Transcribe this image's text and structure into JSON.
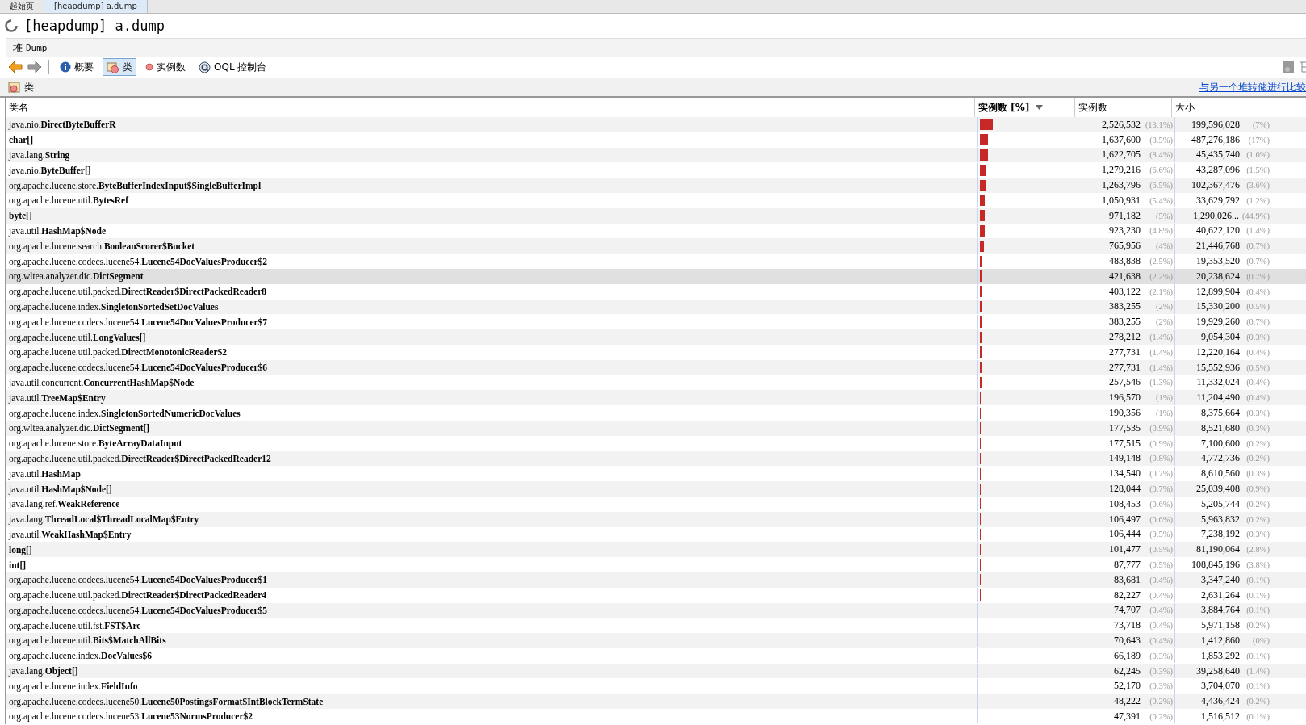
{
  "tabs": [
    {
      "label": "起始页",
      "selected": false
    },
    {
      "label": "[heapdump] a.dump",
      "selected": true
    }
  ],
  "title": "[heapdump] a.dump",
  "breadcrumb": {
    "root": "堆",
    "item": "Dump"
  },
  "toolbar": [
    {
      "kind": "info",
      "label": "概要",
      "selected": false
    },
    {
      "kind": "classes",
      "label": "类",
      "selected": true
    },
    {
      "kind": "instances",
      "label": "实例数",
      "selected": false
    },
    {
      "kind": "oql",
      "label": "OQL 控制台",
      "selected": false
    }
  ],
  "section": {
    "title": "类",
    "link": "与另一个堆转储进行比较"
  },
  "table": {
    "columns": [
      "类名",
      "实例数 [%]",
      "实例数",
      "大小"
    ],
    "rows": [
      {
        "package": "java.nio.",
        "class_name": "DirectByteBufferR",
        "level": 0.131,
        "count": "2,526,532",
        "count_pct": "(13.1%)",
        "size": "199,596,028",
        "size_pct": "(7%)",
        "selected": false
      },
      {
        "class_name": "char[]",
        "level": 0.085,
        "count": "1,637,600",
        "count_pct": "(8.5%)",
        "size": "487,276,186",
        "size_pct": "(17%)",
        "selected": false
      },
      {
        "package": "java.lang.",
        "class_name": "String",
        "level": 0.084,
        "count": "1,622,705",
        "count_pct": "(8.4%)",
        "size": "45,435,740",
        "size_pct": "(1.6%)",
        "selected": false
      },
      {
        "package": "java.nio.",
        "class_name": "ByteBuffer[]",
        "level": 0.066,
        "count": "1,279,216",
        "count_pct": "(6.6%)",
        "size": "43,287,096",
        "size_pct": "(1.5%)",
        "selected": false
      },
      {
        "package": "org.apache.lucene.store.",
        "class_name": "ByteBufferIndexInput$SingleBufferImpl",
        "level": 0.065,
        "count": "1,263,796",
        "count_pct": "(6.5%)",
        "size": "102,367,476",
        "size_pct": "(3.6%)",
        "selected": false
      },
      {
        "package": "org.apache.lucene.util.",
        "class_name": "BytesRef",
        "level": 0.054,
        "count": "1,050,931",
        "count_pct": "(5.4%)",
        "size": "33,629,792",
        "size_pct": "(1.2%)",
        "selected": false
      },
      {
        "class_name": "byte[]",
        "level": 0.05,
        "count": "971,182",
        "count_pct": "(5%)",
        "size": "1,290,026...",
        "size_pct": "(44.9%)",
        "selected": false
      },
      {
        "package": "java.util.",
        "class_name": "HashMap$Node",
        "level": 0.048,
        "count": "923,230",
        "count_pct": "(4.8%)",
        "size": "40,622,120",
        "size_pct": "(1.4%)",
        "selected": false
      },
      {
        "package": "org.apache.lucene.search.",
        "class_name": "BooleanScorer$Bucket",
        "level": 0.04,
        "count": "765,956",
        "count_pct": "(4%)",
        "size": "21,446,768",
        "size_pct": "(0.7%)",
        "selected": false
      },
      {
        "package": "org.apache.lucene.codecs.lucene54.",
        "class_name": "Lucene54DocValuesProducer$2",
        "level": 0.025,
        "count": "483,838",
        "count_pct": "(2.5%)",
        "size": "19,353,520",
        "size_pct": "(0.7%)",
        "selected": false
      },
      {
        "package": "org.wltea.analyzer.dic.",
        "class_name": "DictSegment",
        "level": 0.022,
        "count": "421,638",
        "count_pct": "(2.2%)",
        "size": "20,238,624",
        "size_pct": "(0.7%)",
        "selected": true
      },
      {
        "package": "org.apache.lucene.util.packed.",
        "class_name": "DirectReader$DirectPackedReader8",
        "level": 0.021,
        "count": "403,122",
        "count_pct": "(2.1%)",
        "size": "12,899,904",
        "size_pct": "(0.4%)",
        "selected": false
      },
      {
        "package": "org.apache.lucene.index.",
        "class_name": "SingletonSortedSetDocValues",
        "level": 0.02,
        "count": "383,255",
        "count_pct": "(2%)",
        "size": "15,330,200",
        "size_pct": "(0.5%)",
        "selected": false
      },
      {
        "package": "org.apache.lucene.codecs.lucene54.",
        "class_name": "Lucene54DocValuesProducer$7",
        "level": 0.02,
        "count": "383,255",
        "count_pct": "(2%)",
        "size": "19,929,260",
        "size_pct": "(0.7%)",
        "selected": false
      },
      {
        "package": "org.apache.lucene.util.",
        "class_name": "LongValues[]",
        "level": 0.014,
        "count": "278,212",
        "count_pct": "(1.4%)",
        "size": "9,054,304",
        "size_pct": "(0.3%)",
        "selected": false
      },
      {
        "package": "org.apache.lucene.util.packed.",
        "class_name": "DirectMonotonicReader$2",
        "level": 0.014,
        "count": "277,731",
        "count_pct": "(1.4%)",
        "size": "12,220,164",
        "size_pct": "(0.4%)",
        "selected": false
      },
      {
        "package": "org.apache.lucene.codecs.lucene54.",
        "class_name": "Lucene54DocValuesProducer$6",
        "level": 0.014,
        "count": "277,731",
        "count_pct": "(1.4%)",
        "size": "15,552,936",
        "size_pct": "(0.5%)",
        "selected": false
      },
      {
        "package": "java.util.concurrent.",
        "class_name": "ConcurrentHashMap$Node",
        "level": 0.013,
        "count": "257,546",
        "count_pct": "(1.3%)",
        "size": "11,332,024",
        "size_pct": "(0.4%)",
        "selected": false
      },
      {
        "package": "java.util.",
        "class_name": "TreeMap$Entry",
        "level": 0.01,
        "count": "196,570",
        "count_pct": "(1%)",
        "size": "11,204,490",
        "size_pct": "(0.4%)",
        "selected": false
      },
      {
        "package": "org.apache.lucene.index.",
        "class_name": "SingletonSortedNumericDocValues",
        "level": 0.01,
        "count": "190,356",
        "count_pct": "(1%)",
        "size": "8,375,664",
        "size_pct": "(0.3%)",
        "selected": false
      },
      {
        "package": "org.wltea.analyzer.dic.",
        "class_name": "DictSegment[]",
        "level": 0.009,
        "count": "177,535",
        "count_pct": "(0.9%)",
        "size": "8,521,680",
        "size_pct": "(0.3%)",
        "selected": false
      },
      {
        "package": "org.apache.lucene.store.",
        "class_name": "ByteArrayDataInput",
        "level": 0.009,
        "count": "177,515",
        "count_pct": "(0.9%)",
        "size": "7,100,600",
        "size_pct": "(0.2%)",
        "selected": false
      },
      {
        "package": "org.apache.lucene.util.packed.",
        "class_name": "DirectReader$DirectPackedReader12",
        "level": 0.008,
        "count": "149,148",
        "count_pct": "(0.8%)",
        "size": "4,772,736",
        "size_pct": "(0.2%)",
        "selected": false
      },
      {
        "package": "java.util.",
        "class_name": "HashMap",
        "level": 0.007,
        "count": "134,540",
        "count_pct": "(0.7%)",
        "size": "8,610,560",
        "size_pct": "(0.3%)",
        "selected": false
      },
      {
        "package": "java.util.",
        "class_name": "HashMap$Node[]",
        "level": 0.007,
        "count": "128,044",
        "count_pct": "(0.7%)",
        "size": "25,039,408",
        "size_pct": "(0.9%)",
        "selected": false
      },
      {
        "package": "java.lang.ref.",
        "class_name": "WeakReference",
        "level": 0.006,
        "count": "108,453",
        "count_pct": "(0.6%)",
        "size": "5,205,744",
        "size_pct": "(0.2%)",
        "selected": false
      },
      {
        "package": "java.lang.",
        "class_name": "ThreadLocal$ThreadLocalMap$Entry",
        "level": 0.006,
        "count": "106,497",
        "count_pct": "(0.6%)",
        "size": "5,963,832",
        "size_pct": "(0.2%)",
        "selected": false
      },
      {
        "package": "java.util.",
        "class_name": "WeakHashMap$Entry",
        "level": 0.005,
        "count": "106,444",
        "count_pct": "(0.5%)",
        "size": "7,238,192",
        "size_pct": "(0.3%)",
        "selected": false
      },
      {
        "class_name": "long[]",
        "level": 0.005,
        "count": "101,477",
        "count_pct": "(0.5%)",
        "size": "81,190,064",
        "size_pct": "(2.8%)",
        "selected": false
      },
      {
        "class_name": "int[]",
        "level": 0.005,
        "count": "87,777",
        "count_pct": "(0.5%)",
        "size": "108,845,196",
        "size_pct": "(3.8%)",
        "selected": false
      },
      {
        "package": "org.apache.lucene.codecs.lucene54.",
        "class_name": "Lucene54DocValuesProducer$1",
        "level": 0.004,
        "count": "83,681",
        "count_pct": "(0.4%)",
        "size": "3,347,240",
        "size_pct": "(0.1%)",
        "selected": false
      },
      {
        "package": "org.apache.lucene.util.packed.",
        "class_name": "DirectReader$DirectPackedReader4",
        "level": 0.004,
        "count": "82,227",
        "count_pct": "(0.4%)",
        "size": "2,631,264",
        "size_pct": "(0.1%)",
        "selected": false
      },
      {
        "package": "org.apache.lucene.codecs.lucene54.",
        "class_name": "Lucene54DocValuesProducer$5",
        "count": "74,707",
        "count_pct": "(0.4%)",
        "size": "3,884,764",
        "size_pct": "(0.1%)",
        "selected": false
      },
      {
        "package": "org.apache.lucene.util.fst.",
        "class_name": "FST$Arc",
        "count": "73,718",
        "count_pct": "(0.4%)",
        "size": "5,971,158",
        "size_pct": "(0.2%)",
        "selected": false
      },
      {
        "package": "org.apache.lucene.util.",
        "class_name": "Bits$MatchAllBits",
        "count": "70,643",
        "count_pct": "(0.4%)",
        "size": "1,412,860",
        "size_pct": "(0%)",
        "selected": false
      },
      {
        "package": "org.apache.lucene.index.",
        "class_name": "DocValues$6",
        "count": "66,189",
        "count_pct": "(0.3%)",
        "size": "1,853,292",
        "size_pct": "(0.1%)",
        "selected": false
      },
      {
        "package": "java.lang.",
        "class_name": "Object[]",
        "count": "62,245",
        "count_pct": "(0.3%)",
        "size": "39,258,640",
        "size_pct": "(1.4%)",
        "selected": false
      },
      {
        "package": "org.apache.lucene.index.",
        "class_name": "FieldInfo",
        "count": "52,170",
        "count_pct": "(0.3%)",
        "size": "3,704,070",
        "size_pct": "(0.1%)",
        "selected": false
      },
      {
        "package": "org.apache.lucene.codecs.lucene50.",
        "class_name": "Lucene50PostingsFormat$IntBlockTermState",
        "count": "48,222",
        "count_pct": "(0.2%)",
        "size": "4,436,424",
        "size_pct": "(0.2%)",
        "selected": false
      },
      {
        "package": "org.apache.lucene.codecs.lucene53.",
        "class_name": "Lucene53NormsProducer$2",
        "count": "47,391",
        "count_pct": "(0.2%)",
        "size": "1,516,512",
        "size_pct": "(0.1%)",
        "selected": false
      }
    ]
  }
}
